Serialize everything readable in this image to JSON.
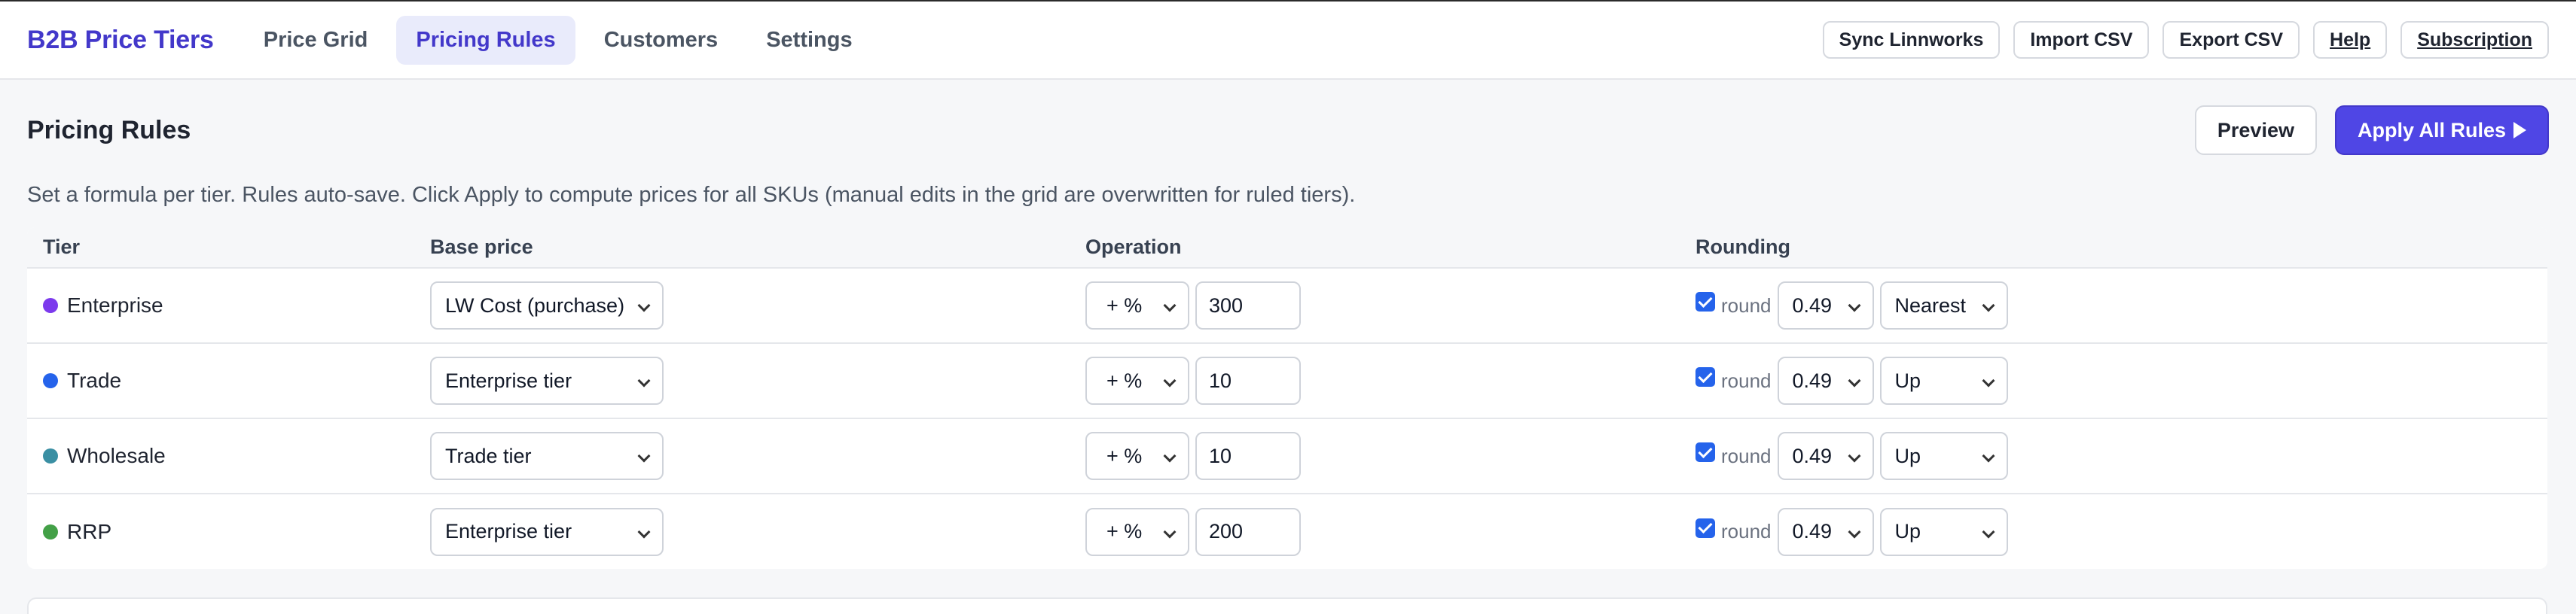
{
  "app": {
    "title": "B2B Price Tiers"
  },
  "nav": {
    "tabs": [
      {
        "label": "Price Grid",
        "active": false
      },
      {
        "label": "Pricing Rules",
        "active": true
      },
      {
        "label": "Customers",
        "active": false
      },
      {
        "label": "Settings",
        "active": false
      }
    ]
  },
  "top_actions": {
    "sync": "Sync Linnworks",
    "import": "Import CSV",
    "export": "Export CSV",
    "help": "Help",
    "subscription": "Subscription"
  },
  "section": {
    "title": "Pricing Rules",
    "preview_label": "Preview",
    "apply_label": "Apply All Rules",
    "description": "Set a formula per tier. Rules auto-save. Click Apply to compute prices for all SKUs (manual edits in the grid are overwritten for ruled tiers)."
  },
  "table": {
    "headers": {
      "tier": "Tier",
      "base": "Base price",
      "operation": "Operation",
      "rounding": "Rounding"
    },
    "round_label": "round",
    "rows": [
      {
        "tier": "Enterprise",
        "color": "#7c3aed",
        "base": "LW Cost (purchase)",
        "op": "+ %",
        "value": "300",
        "round_enabled": true,
        "round_to": "0.49",
        "direction": "Nearest"
      },
      {
        "tier": "Trade",
        "color": "#2563eb",
        "base": "Enterprise tier",
        "op": "+ %",
        "value": "10",
        "round_enabled": true,
        "round_to": "0.49",
        "direction": "Up"
      },
      {
        "tier": "Wholesale",
        "color": "#3a8fa3",
        "base": "Trade tier",
        "op": "+ %",
        "value": "10",
        "round_enabled": true,
        "round_to": "0.49",
        "direction": "Up"
      },
      {
        "tier": "RRP",
        "color": "#43a047",
        "base": "Enterprise tier",
        "op": "+ %",
        "value": "200",
        "round_enabled": true,
        "round_to": "0.49",
        "direction": "Up"
      }
    ]
  },
  "colors": {
    "accent": "#4f46e5",
    "brand": "#4338ca",
    "checkbox": "#2563eb"
  }
}
